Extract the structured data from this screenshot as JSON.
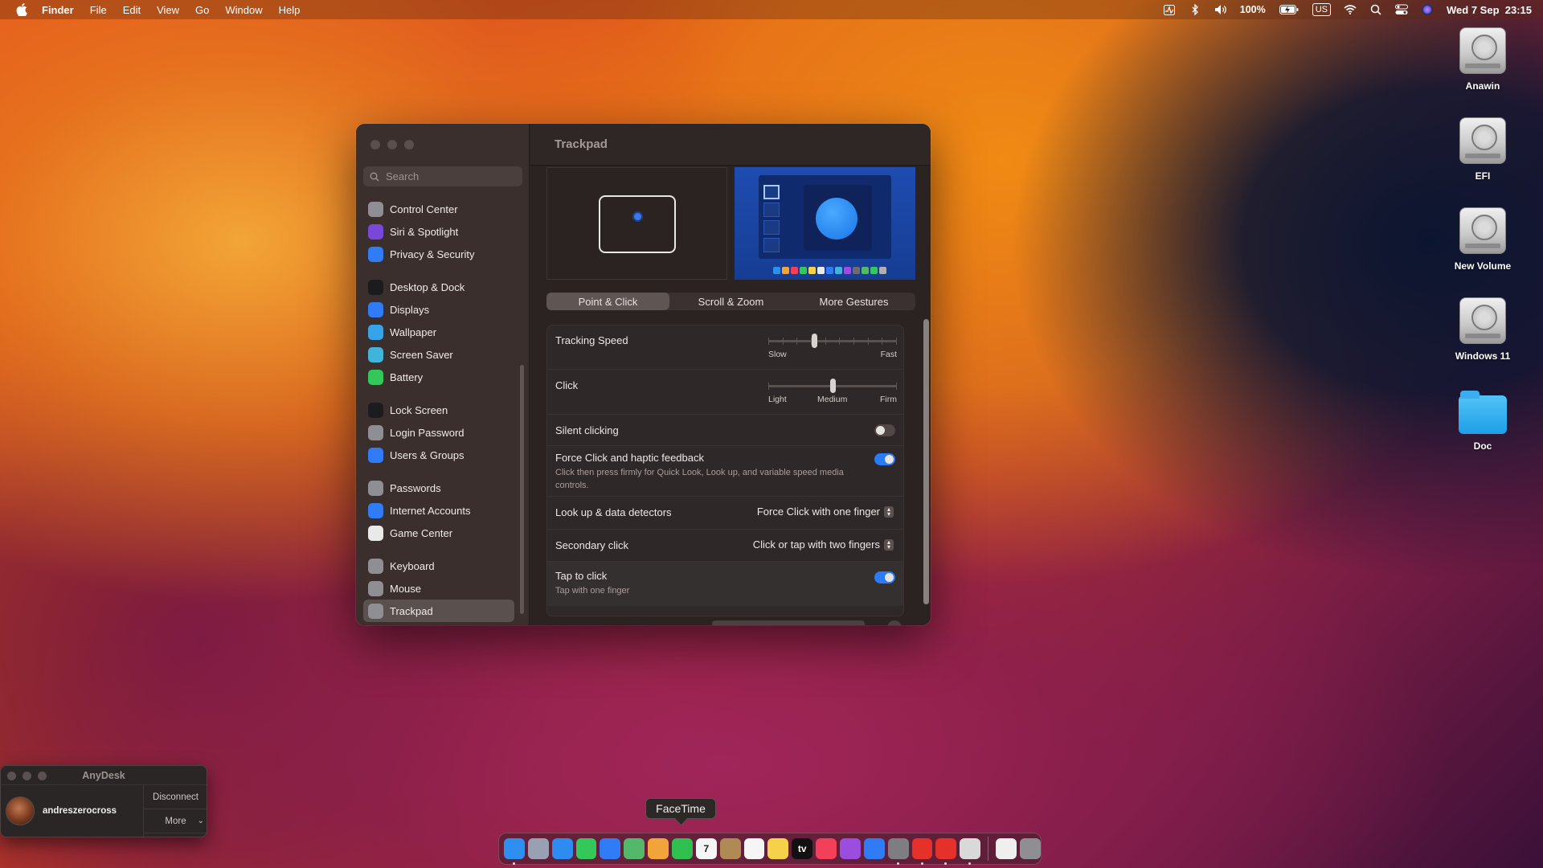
{
  "menubar": {
    "app": "Finder",
    "items": [
      "File",
      "Edit",
      "View",
      "Go",
      "Window",
      "Help"
    ],
    "battery": "100%",
    "input_source": "US",
    "datetime": "Wed 7 Sep  23:15"
  },
  "desktop": {
    "icons": [
      {
        "label": "Anawin",
        "kind": "drive"
      },
      {
        "label": "EFI",
        "kind": "drive"
      },
      {
        "label": "New Volume",
        "kind": "drive"
      },
      {
        "label": "Windows 11",
        "kind": "drive"
      },
      {
        "label": "Doc",
        "kind": "folder"
      }
    ]
  },
  "settings": {
    "search_placeholder": "Search",
    "title": "Trackpad",
    "sidebar": [
      [
        {
          "label": "Control Center",
          "icon": "control-center-icon",
          "color": "#8e8e93"
        },
        {
          "label": "Siri & Spotlight",
          "icon": "siri-icon",
          "color": "#7a48d8"
        },
        {
          "label": "Privacy & Security",
          "icon": "hand-icon",
          "color": "#2f7cf6"
        }
      ],
      [
        {
          "label": "Desktop & Dock",
          "icon": "desktop-dock-icon",
          "color": "#1c1c1e"
        },
        {
          "label": "Displays",
          "icon": "sun-icon",
          "color": "#2f7cf6"
        },
        {
          "label": "Wallpaper",
          "icon": "flower-icon",
          "color": "#36a4e8"
        },
        {
          "label": "Screen Saver",
          "icon": "screen-saver-icon",
          "color": "#41b4d9"
        },
        {
          "label": "Battery",
          "icon": "battery-icon",
          "color": "#34c759"
        }
      ],
      [
        {
          "label": "Lock Screen",
          "icon": "lock-icon",
          "color": "#1c1c1e"
        },
        {
          "label": "Login Password",
          "icon": "key-lock-icon",
          "color": "#8e8e93"
        },
        {
          "label": "Users & Groups",
          "icon": "users-icon",
          "color": "#2f7cf6"
        }
      ],
      [
        {
          "label": "Passwords",
          "icon": "key-icon",
          "color": "#8e8e93"
        },
        {
          "label": "Internet Accounts",
          "icon": "at-icon",
          "color": "#2f7cf6"
        },
        {
          "label": "Game Center",
          "icon": "game-center-icon",
          "color": "#e9e9e9"
        }
      ],
      [
        {
          "label": "Keyboard",
          "icon": "keyboard-icon",
          "color": "#8e8e93"
        },
        {
          "label": "Mouse",
          "icon": "mouse-icon",
          "color": "#8e8e93"
        },
        {
          "label": "Trackpad",
          "icon": "trackpad-icon",
          "color": "#8e8e93",
          "active": true
        }
      ]
    ],
    "tabs": [
      "Point & Click",
      "Scroll & Zoom",
      "More Gestures"
    ],
    "active_tab": "Point & Click",
    "rows": {
      "tracking_speed": {
        "label": "Tracking Speed",
        "min_label": "Slow",
        "max_label": "Fast",
        "value": 0.35
      },
      "click": {
        "label": "Click",
        "min_label": "Light",
        "mid_label": "Medium",
        "max_label": "Firm",
        "value": 0.5
      },
      "silent_clicking": {
        "label": "Silent clicking",
        "on": false
      },
      "force_click": {
        "label": "Force Click and haptic feedback",
        "description": "Click then press firmly for Quick Look, Look up, and variable speed media controls.",
        "on": true
      },
      "lookup": {
        "label": "Look up & data detectors",
        "value": "Force Click with one finger"
      },
      "secondary_click": {
        "label": "Secondary click",
        "value": "Click or tap with two fingers"
      },
      "tap_to_click": {
        "label": "Tap to click",
        "description": "Tap with one finger",
        "on": true
      }
    }
  },
  "anydesk": {
    "title": "AnyDesk",
    "user": "andreszerocross",
    "disconnect": "Disconnect",
    "more": "More"
  },
  "dock": {
    "tooltip": "FaceTime",
    "apps": [
      {
        "name": "finder-icon",
        "color": "#2f8ef0",
        "running": true
      },
      {
        "name": "launchpad-icon",
        "color": "#9aa0b4"
      },
      {
        "name": "safari-icon",
        "color": "#2c8cf0"
      },
      {
        "name": "messages-icon",
        "color": "#34c759"
      },
      {
        "name": "mail-icon",
        "color": "#2f7cf6"
      },
      {
        "name": "maps-icon",
        "color": "#54b86a"
      },
      {
        "name": "photos-icon",
        "color": "#f2a33a"
      },
      {
        "name": "facetime-icon",
        "color": "#30c04f"
      },
      {
        "name": "calendar-icon",
        "color": "#f5f5f5",
        "label": "7"
      },
      {
        "name": "archive-icon",
        "color": "#b08a55"
      },
      {
        "name": "reminders-icon",
        "color": "#f5f5f5"
      },
      {
        "name": "notes-icon",
        "color": "#f6d24a"
      },
      {
        "name": "tv-icon",
        "color": "#111111",
        "label": "tv"
      },
      {
        "name": "music-icon",
        "color": "#f2405a"
      },
      {
        "name": "podcasts-icon",
        "color": "#9b4de0"
      },
      {
        "name": "app-store-icon",
        "color": "#2f7cf6"
      },
      {
        "name": "system-settings-icon",
        "color": "#7d7d82",
        "running": true
      },
      {
        "name": "anydesk-icon",
        "color": "#e6312b",
        "running": true
      },
      {
        "name": "anydesk-alt-icon",
        "color": "#e6312b",
        "running": true
      },
      {
        "name": "preview-icon",
        "color": "#d9d9d9",
        "running": true
      }
    ],
    "after_separator": [
      {
        "name": "document-icon",
        "color": "#efefef"
      },
      {
        "name": "trash-icon",
        "color": "#8f8f93"
      }
    ]
  }
}
